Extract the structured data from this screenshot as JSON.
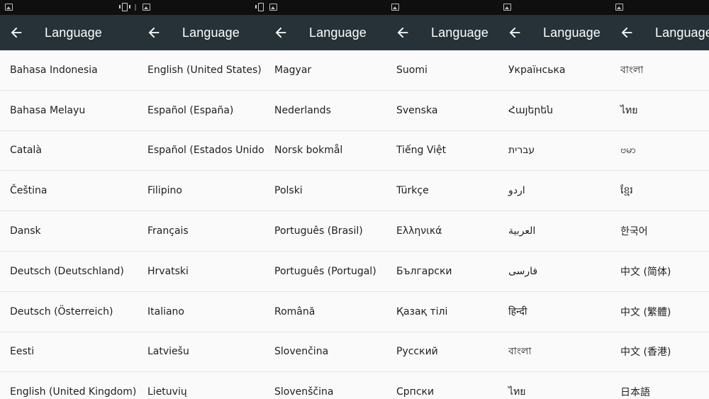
{
  "screen_title": "Language",
  "panels": [
    {
      "items": [
        "Bahasa Indonesia",
        "Bahasa Melayu",
        "Català",
        "Čeština",
        "Dansk",
        "Deutsch (Deutschland)",
        "Deutsch (Österreich)",
        "Eesti",
        "English (United Kingdom)"
      ]
    },
    {
      "items": [
        "English (United States)",
        "Español (España)",
        "Español (Estados Unidos)",
        "Filipino",
        "Français",
        "Hrvatski",
        "Italiano",
        "Latviešu",
        "Lietuvių"
      ]
    },
    {
      "items": [
        "Magyar",
        "Nederlands",
        "Norsk bokmål",
        "Polski",
        "Português (Brasil)",
        "Português (Portugal)",
        "Română",
        "Slovenčina",
        "Slovenščina"
      ]
    },
    {
      "items": [
        "Suomi",
        "Svenska",
        "Tiếng Việt",
        "Türkçe",
        "Ελληνικά",
        "Български",
        "Қазақ тілі",
        "Русский",
        "Српски"
      ]
    },
    {
      "items": [
        "Українська",
        "Հայերեն",
        "עברית",
        "اردو",
        "العربية",
        "فارسی",
        "हिन्दी",
        "বাংলা",
        "ไทย"
      ]
    },
    {
      "items": [
        "বাংলা",
        "ไทย",
        "ဗမာ",
        "ខ្មែរ",
        "한국어",
        "中文 (简体)",
        "中文 (繁體)",
        "中文 (香港)",
        "日本語"
      ]
    }
  ],
  "icons": {
    "back": "arrow-back-icon",
    "status_image": "image-icon",
    "status_vibrate": "vibrate-icon"
  },
  "colors": {
    "appbar": "#263238",
    "statusbar": "#0f0f0f",
    "list_bg": "#fafafa",
    "divider": "#e6e6e6",
    "text": "#212121"
  }
}
